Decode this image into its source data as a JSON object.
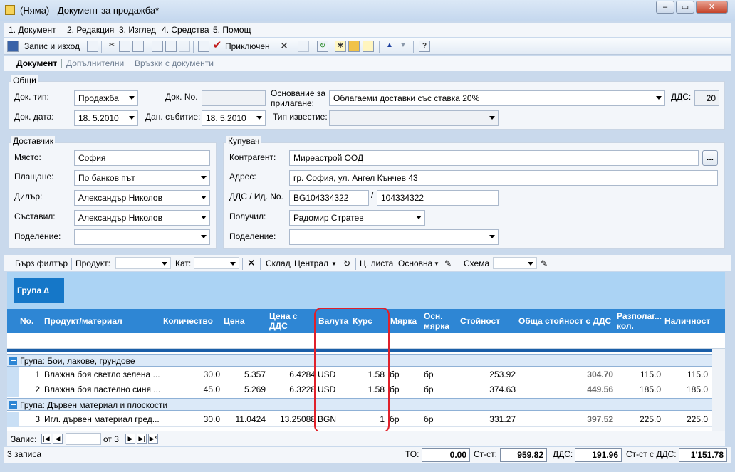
{
  "window": {
    "title": "(Няма) - Документ за продажба*",
    "min_btn": "–",
    "max_btn": "▭",
    "close_btn": "✕"
  },
  "menu": [
    "1. Документ",
    "2. Редакция",
    "3. Изглед",
    "4. Средства",
    "5. Помощ"
  ],
  "toolbar": {
    "save_exit": "Запис и изход",
    "post": "Приключен"
  },
  "tabs": [
    "Документ",
    "Допълнителни",
    "Връзки с документи"
  ],
  "general": {
    "legend": "Общи",
    "doc_type_label": "Док. тип:",
    "doc_type": "Продажба",
    "doc_no_label": "Док. No.",
    "doc_no": "",
    "basis_label": "Основание за прилагане:",
    "basis": "Облагаеми доставки със ставка 20%",
    "vat_label": "ДДС:",
    "vat": "20",
    "doc_date_label": "Док. дата:",
    "doc_date": "18. 5.2010",
    "tax_event_label": "Дан. събитие:",
    "tax_event": "18. 5.2010",
    "notice_type_label": "Тип известие:",
    "notice_type": ""
  },
  "supplier": {
    "legend": "Доставчик",
    "place_label": "Място:",
    "place": "София",
    "payment_label": "Плащане:",
    "payment": "По банков път",
    "dealer_label": "Дилър:",
    "dealer": "Александър Николов",
    "composed_label": "Съставил:",
    "composed": "Александър Николов",
    "division_label": "Поделение:",
    "division": ""
  },
  "buyer": {
    "legend": "Купувач",
    "contractor_label": "Контрагент:",
    "contractor": "Миреастрой ООД",
    "browse": "...",
    "address_label": "Адрес:",
    "address": "гр. София, ул. Ангел Кънчев 43",
    "vat_id_label": "ДДС / Ид. No.",
    "vat_no": "BG104334322",
    "id_no": "104334322",
    "sep": "/",
    "receiver_label": "Получил:",
    "receiver": "Радомир Стратев",
    "division_label": "Поделение:",
    "division": ""
  },
  "filters": {
    "quick": "Бърз филтър",
    "product": "Продукт:",
    "cat": "Кат:",
    "store_label": "Склад",
    "store": "Централ",
    "pricelist_label": "Ц. листа",
    "pricelist": "Основна",
    "scheme_label": "Схема"
  },
  "grid": {
    "group_button": "Група ∆",
    "columns": [
      "No.",
      "Продукт/материал",
      "Количество",
      "Цена",
      "Цена с ДДС",
      "Валута",
      "Курс",
      "Мярка",
      "Осн. мярка",
      "Стойност",
      "Обща стойност с ДДС",
      "Разполаг... кол.",
      "Наличност"
    ],
    "groups": [
      {
        "title": "Група: Бои, лакове, грундове",
        "rows": [
          [
            "1",
            "Влажна боя светло зелена ...",
            "30.0",
            "5.357",
            "6.4284",
            "USD",
            "1.58",
            "бр",
            "бр",
            "253.92",
            "304.70",
            "115.0",
            "115.0"
          ],
          [
            "2",
            "Влажна боя пастелно синя ...",
            "45.0",
            "5.269",
            "6.3228",
            "USD",
            "1.58",
            "бр",
            "бр",
            "374.63",
            "449.56",
            "185.0",
            "185.0"
          ]
        ]
      },
      {
        "title": "Група: Дървен материал и плоскости",
        "rows": [
          [
            "3",
            "Игл. дървен материал гред...",
            "30.0",
            "11.0424",
            "13.25088",
            "BGN",
            "1",
            "бр",
            "бр",
            "331.27",
            "397.52",
            "225.0",
            "225.0"
          ]
        ]
      }
    ]
  },
  "nav": {
    "record_label": "Запис:",
    "of": "от 3"
  },
  "status": {
    "count": "3 записа",
    "to_label": "ТО:",
    "to": "0.00",
    "value_label": "Ст-ст:",
    "value": "959.82",
    "vat_label": "ДДС:",
    "vat": "191.96",
    "total_label": "Ст-ст с ДДС:",
    "total": "1'151.78"
  }
}
